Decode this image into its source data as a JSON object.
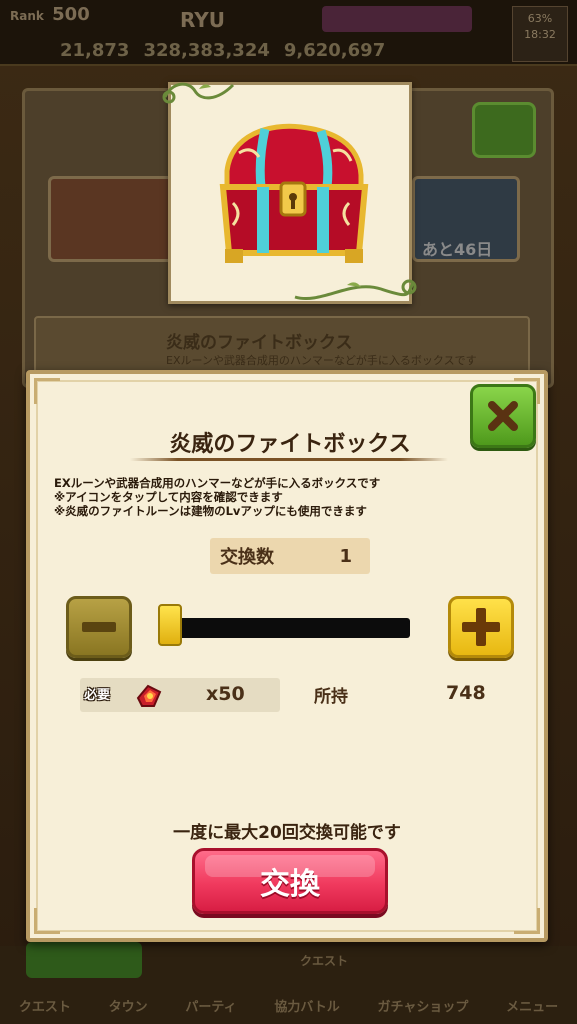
{
  "background": {
    "status_bar": {
      "rank_label": "Rank",
      "rank_value": "500",
      "player_name": "RYU",
      "currencies": [
        "21,873",
        "328,383,324",
        "9,620,697"
      ],
      "battery": "63%",
      "time": "18:32"
    },
    "remaining_days": "あと46日",
    "item_row": {
      "title": "炎威のファイトボックス",
      "desc": "EXルーンや武器合成用のハンマーなどが手に入るボックスです"
    },
    "nav": {
      "items": [
        "クエスト",
        "タウン",
        "パーティ",
        "協力バトル",
        "ガチャショップ",
        "メニュー"
      ],
      "sub_label": "クエスト"
    }
  },
  "dialog": {
    "title": "炎威のファイトボックス",
    "description": [
      "EXルーンや武器合成用のハンマーなどが手に入るボックスです",
      "※アイコンをタップして内容を確認できます",
      "※炎威のファイトルーンは建物のLvアップにも使用できます"
    ],
    "exchange_count": {
      "label": "交換数",
      "value": "1"
    },
    "slider": {
      "value": 1,
      "min": 1,
      "max": 20
    },
    "required": {
      "label": "必要",
      "icon": "fight-rune-icon",
      "amount": "x50"
    },
    "owned": {
      "label": "所持",
      "value": "748"
    },
    "limit_note": "一度に最大20回交換可能です",
    "exchange_button": "交換"
  },
  "colors": {
    "accent_pink": "#f03a5e",
    "close_green": "#4f9a1c",
    "plus_yellow": "#ffd21e",
    "panel_cream": "#f7efd8"
  }
}
